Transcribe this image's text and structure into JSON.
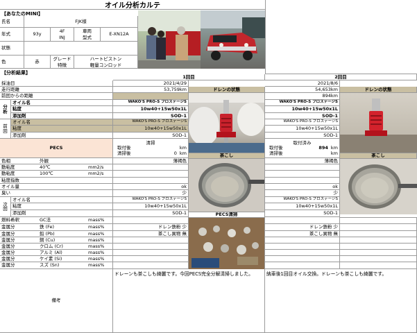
{
  "title": "オイル分析カルテ",
  "mini_section": "【あなたのMINI】",
  "owner": {
    "label": "氏名",
    "value": "FJK様"
  },
  "year": {
    "label": "年式",
    "value": "93y",
    "engine_top": "4F",
    "engine_bottom": "INJ",
    "model_label_top": "車両",
    "model_label_bottom": "型式",
    "model_value": "E-XN12A"
  },
  "condition": {
    "label": "状態"
  },
  "color": {
    "label": "色",
    "value": "赤",
    "grade_label_top": "グレード",
    "grade_label_bottom": "特徴",
    "grade_value_top": "ハートピストン",
    "grade_value_bottom": "軽量コンロッド"
  },
  "analysis_section": "【分析結果】",
  "rounds": {
    "first": "1回目",
    "second": "2回目"
  },
  "rows": {
    "sample_date": "採油日",
    "mileage": "走行距離",
    "since_change": "前回からの距離",
    "analysis_side": [
      "分",
      "析"
    ],
    "oil_name": "オイル名",
    "viscosity": "粘度",
    "additive": "添加剤",
    "prev_side": [
      "前",
      "回"
    ],
    "oil_name2": "オイル名",
    "viscosity2": "粘度",
    "additive2": "添加剤",
    "pecs": "PECS",
    "hue": "色相",
    "kin40": "動粘度",
    "kin100": "動粘度",
    "vis_index": "粘度指数",
    "oil_amount": "オイル量",
    "smell": "臭い",
    "next_side": [
      "次",
      "回"
    ],
    "oil_name3": "オイル名",
    "viscosity3": "粘度",
    "additive3": "添加剤"
  },
  "sub_labels": {
    "appearance": "外観",
    "t40": "40℃",
    "t100": "100℃",
    "unit_cst": "mm2/s",
    "unit_cst2": "mm2/s"
  },
  "metals": {
    "header_label": "燃料希釈",
    "header_method": "GC法",
    "header_unit": "mass%",
    "items": [
      {
        "label": "金属分",
        "name": "鉄 (Fe)",
        "unit": "mass%"
      },
      {
        "label": "金属分",
        "name": "鉛 (Pb)",
        "unit": "mass%"
      },
      {
        "label": "金属分",
        "name": "銅 (Cu)",
        "unit": "mass%"
      },
      {
        "label": "金属分",
        "name": "クロム (Cr)",
        "unit": "mass%"
      },
      {
        "label": "金属分",
        "name": "アルミ (Al)",
        "unit": "mass%"
      },
      {
        "label": "金属分",
        "name": "ケイ素 (Si)",
        "unit": "mass%"
      },
      {
        "label": "金属分",
        "name": "スズ (Sn)",
        "unit": "mass%"
      }
    ]
  },
  "first": {
    "date": "2021/4/29",
    "mileage": "53,759km",
    "oil": "WAKO'S PRO-S プロステージS",
    "viscosity": "10w40+15w50x1L",
    "additive": "SOD-1",
    "prev_oil": "WAKO'S PRO-S プロステージS",
    "prev_viscosity": "10w40+15w50x1L",
    "prev_additive": "SOD-1",
    "pecs_status": "清掃",
    "pecs_fit_label": "取付後",
    "pecs_fit_val": "",
    "pecs_fit_unit": "km",
    "pecs_clean_label": "清掃後",
    "pecs_clean_val": "0",
    "pecs_clean_unit": "km",
    "hue": "薄褐色",
    "oil_amount": "ok",
    "smell": "少",
    "next_oil": "WAKO'S PRO-S プロステージS",
    "next_viscosity": "10w40+15w50x1L",
    "next_additive": "SOD-1",
    "drain_note": "ドレン鉄粉 少",
    "strainer_note": "茶こし異物 無",
    "remarks": "ドレーンも茶こしも綺麗です。今回PECS完全分解清掃しました。"
  },
  "second": {
    "date": "2021/8/6",
    "mileage": "54,653km",
    "since": "894km",
    "oil": "WAKO'S PRO-S プロステージS",
    "viscosity": "10w40+15w50x1L",
    "additive": "SOD-1",
    "prev_oil": "WAKO'S PRO-S プロステージS",
    "prev_viscosity": "10w40+15w50x1L",
    "prev_additive": "SOD-1",
    "pecs_status": "取付済み",
    "pecs_fit_label": "取付後",
    "pecs_fit_val": "894",
    "pecs_fit_unit": "km",
    "pecs_clean_label": "清掃後",
    "pecs_clean_val": "",
    "pecs_clean_unit": "km",
    "hue": "薄褐色",
    "oil_amount": "ok",
    "smell": "少",
    "next_oil": "WAKO'S PRO-S プロステージS",
    "next_viscosity": "10w40+15w50x1L",
    "next_additive": "SOD-1",
    "drain_note": "ドレン鉄粉 少",
    "strainer_note": "茶こし異物 無",
    "remarks": "納車後1回目オイル交換。ドレーンも茶こしも綺麗です。"
  },
  "photo_labels": {
    "drain": "ドレンの状態",
    "strainer": "茶こし",
    "pecs_clean": "PECS清掃",
    "drain2": "ドレンの状態",
    "strainer2": "茶こし"
  },
  "remarks_label": "備考",
  "colors": {
    "tan": "#c9bfa2",
    "peach": "#fbe4d5",
    "header": "#ddd6c0"
  }
}
